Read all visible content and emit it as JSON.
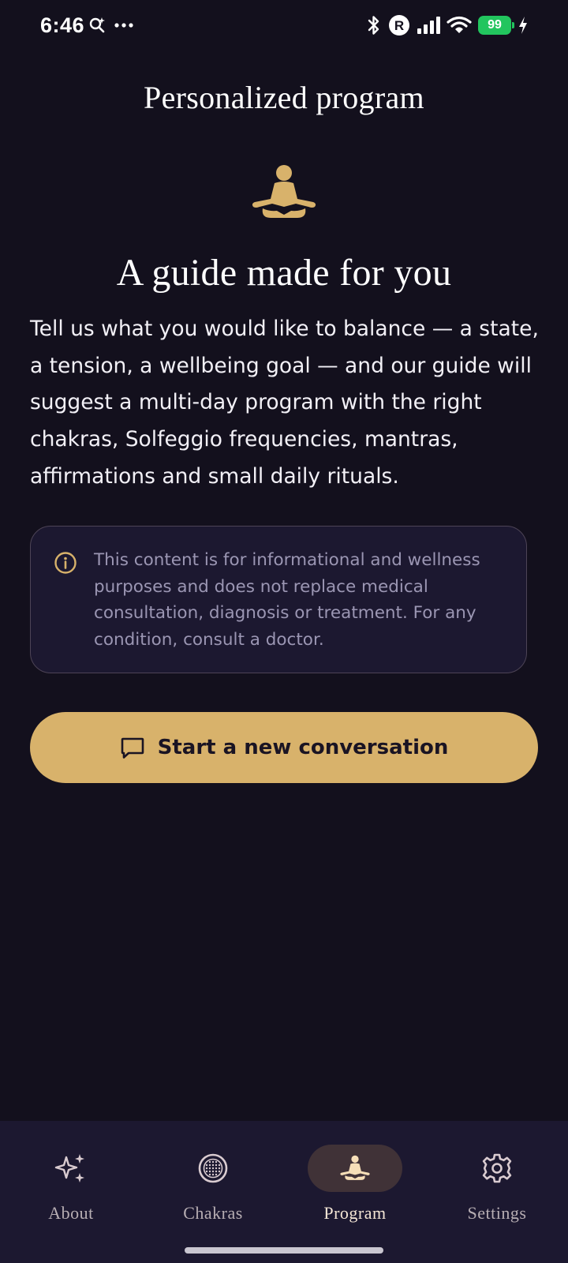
{
  "status_bar": {
    "time": "6:46",
    "battery": "99"
  },
  "header": {
    "title": "Personalized program"
  },
  "hero": {
    "icon": "meditation-icon",
    "title": "A guide made for you",
    "description": "Tell us what you would like to balance — a state, a tension, a wellbeing goal — and our guide will suggest a multi-day program with the right chakras, Solfeggio frequencies, mantras, affirmations and small daily rituals."
  },
  "disclaimer": {
    "icon": "info-icon",
    "text": "This content is for informational and wellness purposes and does not replace medical consultation, diagnosis or treatment. For any condition, consult a doctor."
  },
  "cta": {
    "icon": "chat-bubble-icon",
    "label": "Start a new conversation"
  },
  "nav": {
    "items": [
      {
        "label": "About",
        "icon": "sparkles-icon",
        "active": false
      },
      {
        "label": "Chakras",
        "icon": "chakra-circle-icon",
        "active": false
      },
      {
        "label": "Program",
        "icon": "meditation-icon",
        "active": true
      },
      {
        "label": "Settings",
        "icon": "gear-icon",
        "active": false
      }
    ]
  },
  "colors": {
    "background": "#13101d",
    "accent_gold": "#d8b26b",
    "card_background": "#1c1830",
    "muted_text": "#9b96b3",
    "battery_green": "#22c55e"
  }
}
